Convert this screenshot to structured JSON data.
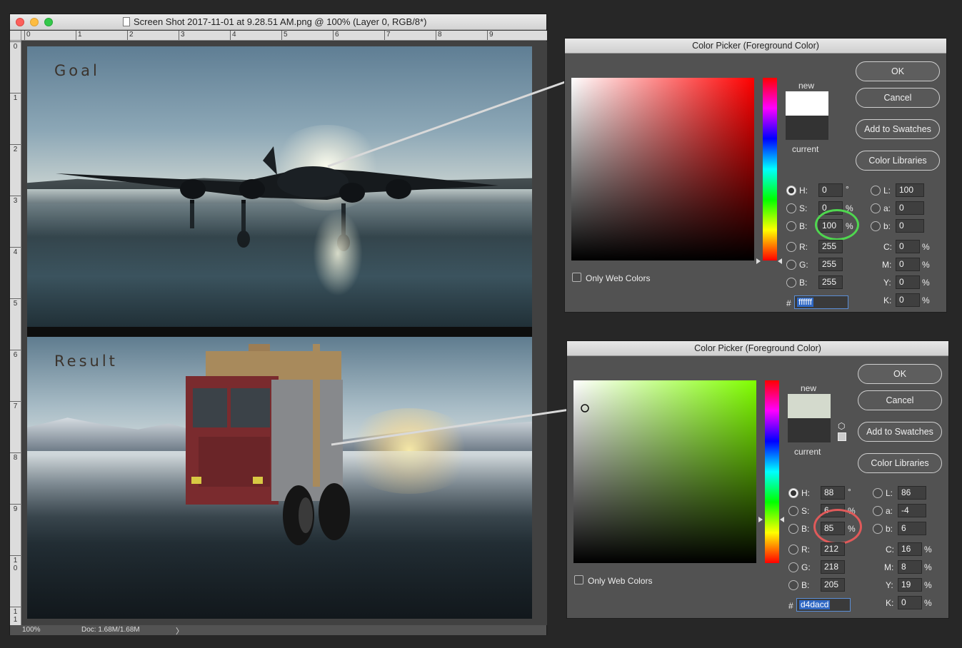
{
  "document": {
    "title": "Screen Shot 2017-11-01 at 9.28.51 AM.png @ 100% (Layer 0, RGB/8*)",
    "ruler_h": [
      "0",
      "1",
      "2",
      "3",
      "4",
      "5",
      "6",
      "7",
      "8",
      "9"
    ],
    "ruler_v": [
      "0",
      "1",
      "2",
      "3",
      "4",
      "5",
      "6",
      "7",
      "8",
      "9",
      "1\n0",
      "1\n1"
    ],
    "top_image_label": "Goal",
    "bottom_image_label": "Result",
    "status": {
      "zoom": "100%",
      "doc_size": "Doc: 1.68M/1.68M",
      "arrow": "〉"
    }
  },
  "picker_goal": {
    "title": "Color Picker (Foreground Color)",
    "new_label": "new",
    "current_label": "current",
    "new_color": "#ffffff",
    "current_color": "#333333",
    "hue_color": "#ff0000",
    "buttons": {
      "ok": "OK",
      "cancel": "Cancel",
      "swatches": "Add to Swatches",
      "libraries": "Color Libraries"
    },
    "hsb": {
      "h_label": "H:",
      "h": "0",
      "h_unit": "°",
      "s_label": "S:",
      "s": "0",
      "s_unit": "%",
      "b_label": "B:",
      "b": "100",
      "b_unit": "%"
    },
    "rgb": {
      "r_label": "R:",
      "r": "255",
      "g_label": "G:",
      "g": "255",
      "b_label": "B:",
      "b": "255"
    },
    "lab": {
      "l_label": "L:",
      "l": "100",
      "a_label": "a:",
      "a": "0",
      "b_label": "b:",
      "b": "0"
    },
    "cmyk": {
      "c_label": "C:",
      "c": "0",
      "m_label": "M:",
      "m": "0",
      "y_label": "Y:",
      "y": "0",
      "k_label": "K:",
      "k": "0",
      "unit": "%"
    },
    "hex_label": "#",
    "hex": "ffffff",
    "only_web_colors": "Only Web Colors",
    "highlight_color": "#4fd64f"
  },
  "picker_result": {
    "title": "Color Picker (Foreground Color)",
    "new_label": "new",
    "current_label": "current",
    "new_color": "#d4dacd",
    "current_color": "#333333",
    "hue_color": "#80ff00",
    "buttons": {
      "ok": "OK",
      "cancel": "Cancel",
      "swatches": "Add to Swatches",
      "libraries": "Color Libraries"
    },
    "hsb": {
      "h_label": "H:",
      "h": "88",
      "h_unit": "°",
      "s_label": "S:",
      "s": "6",
      "s_unit": "%",
      "b_label": "B:",
      "b": "85",
      "b_unit": "%"
    },
    "rgb": {
      "r_label": "R:",
      "r": "212",
      "g_label": "G:",
      "g": "218",
      "b_label": "B:",
      "b": "205"
    },
    "lab": {
      "l_label": "L:",
      "l": "86",
      "a_label": "a:",
      "a": "-4",
      "b_label": "b:",
      "b": "6"
    },
    "cmyk": {
      "c_label": "C:",
      "c": "16",
      "m_label": "M:",
      "m": "8",
      "y_label": "Y:",
      "y": "19",
      "k_label": "K:",
      "k": "0",
      "unit": "%"
    },
    "hex_label": "#",
    "hex": "d4dacd",
    "only_web_colors": "Only Web Colors",
    "gamut_warning_icon": "cube-icon",
    "highlight_color": "#e05a5a"
  }
}
